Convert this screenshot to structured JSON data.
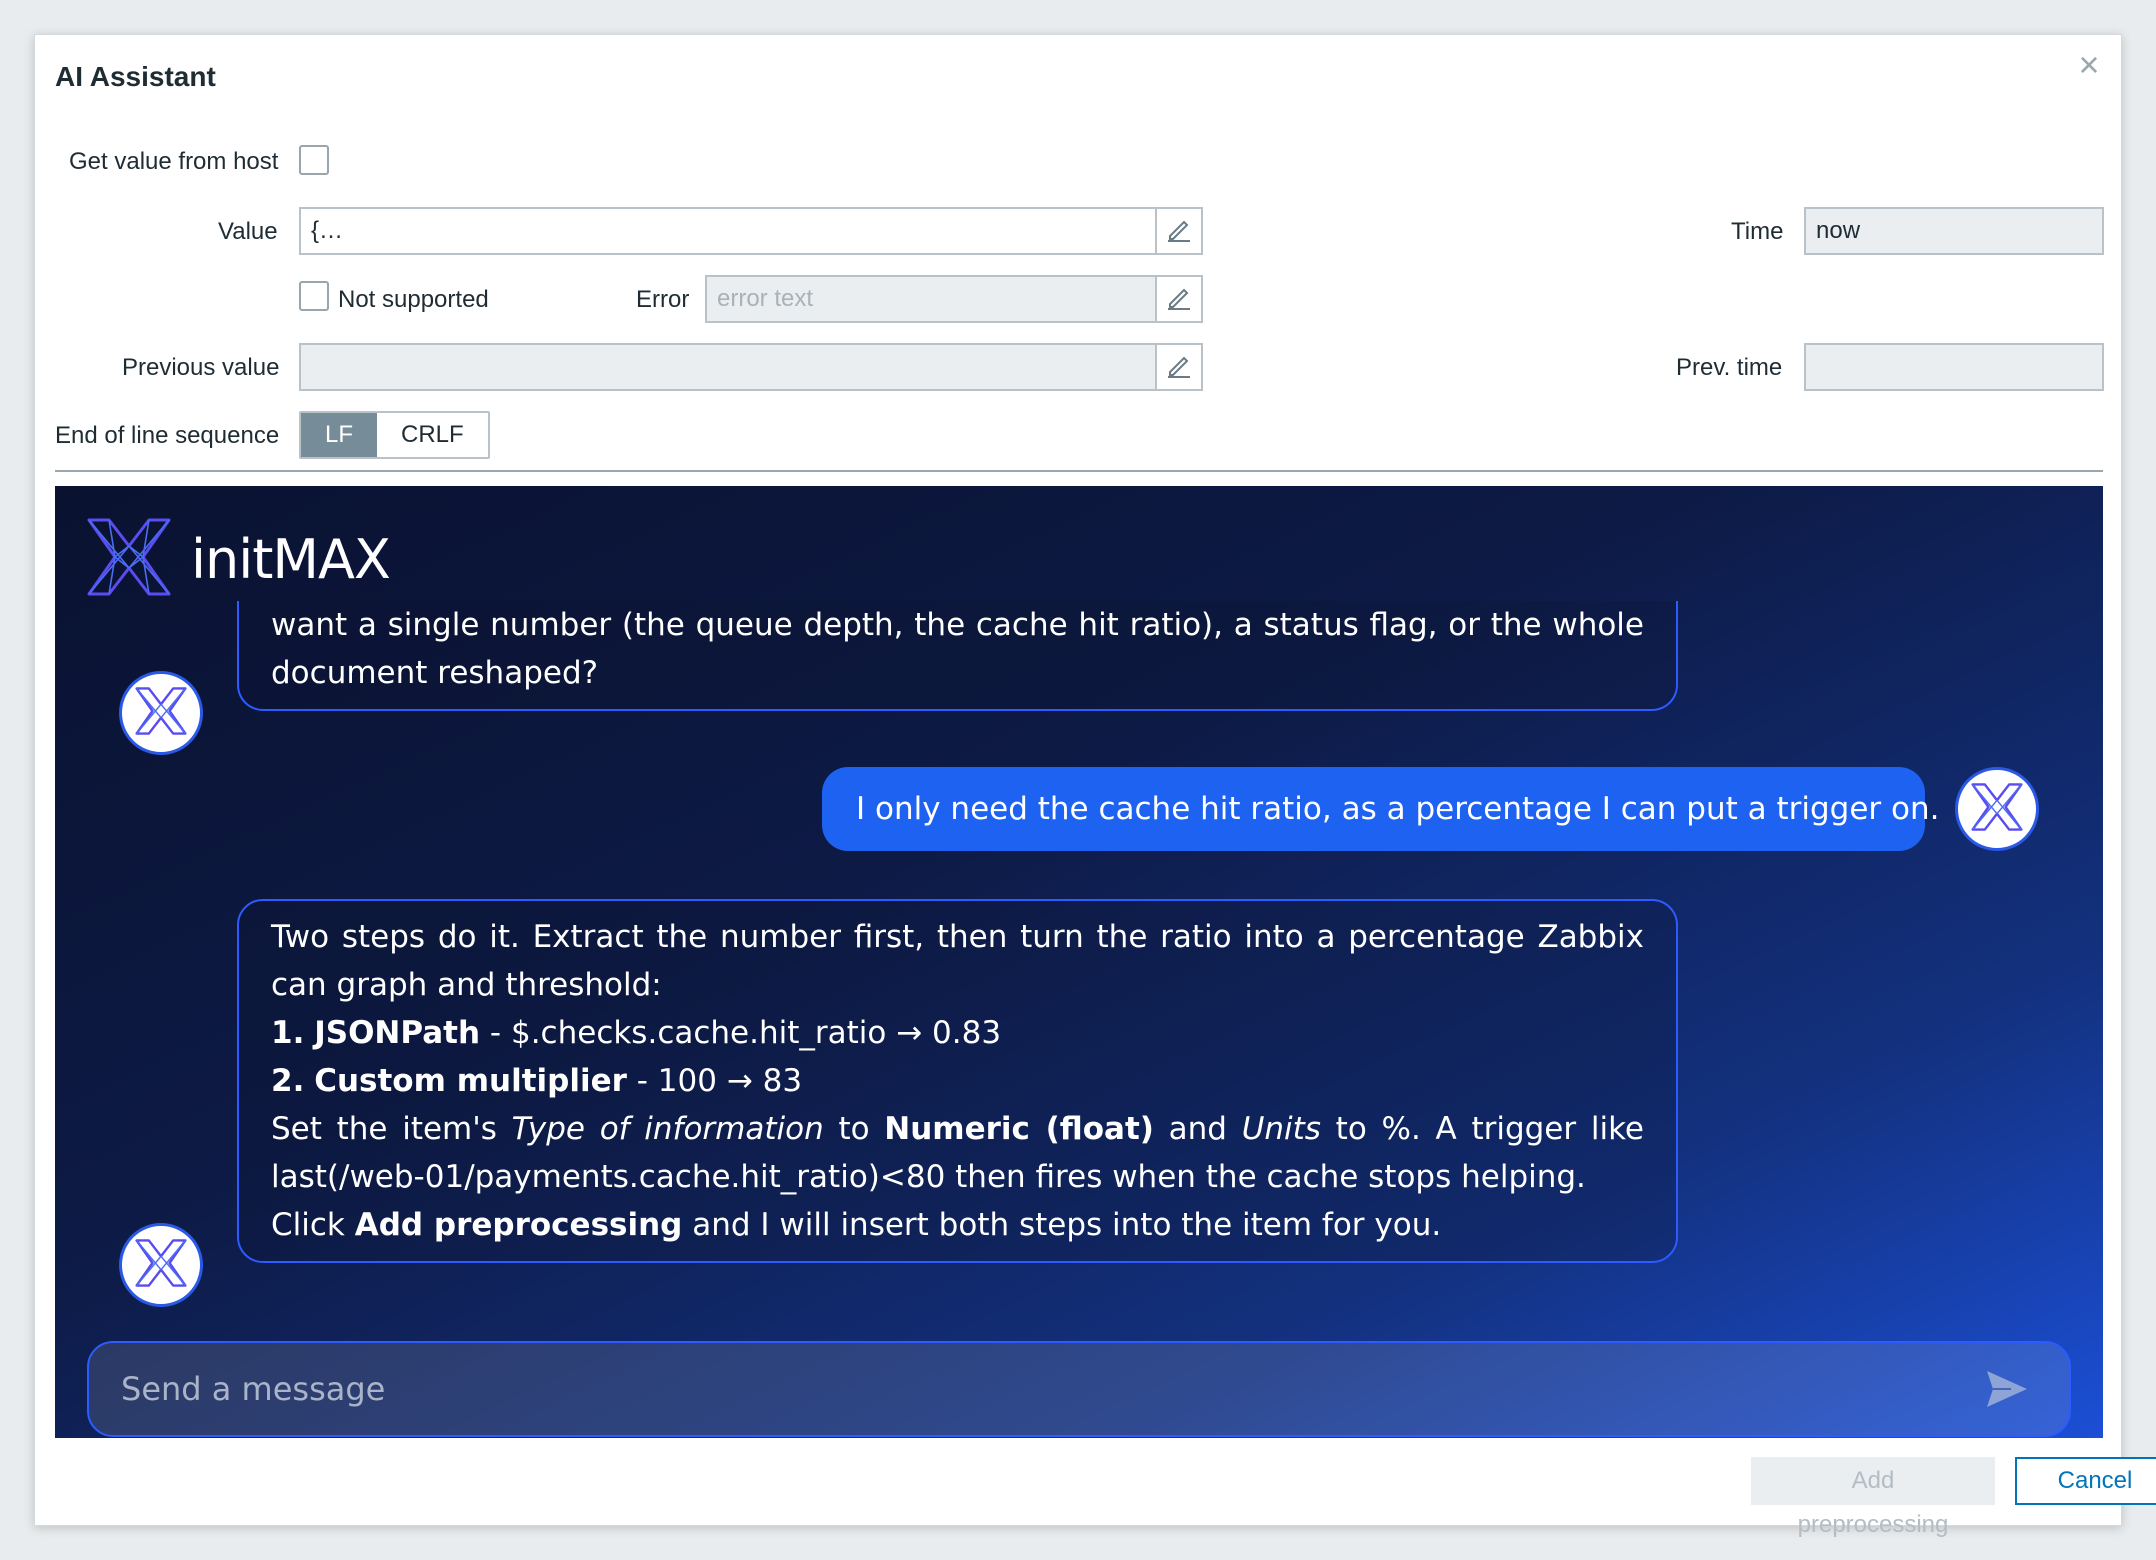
{
  "dialog": {
    "title": "AI Assistant",
    "close_symbol": "×"
  },
  "form": {
    "get_value_label": "Get value from host",
    "value_label": "Value",
    "value_text": "{…",
    "time_label": "Time",
    "time_value": "now",
    "not_supported_label": "Not supported",
    "error_label": "Error",
    "error_placeholder": "error text",
    "previous_value_label": "Previous value",
    "previous_value": "",
    "prev_time_label": "Prev. time",
    "prev_time_value": "",
    "eol_label": "End of line sequence",
    "eol_options": [
      "LF",
      "CRLF"
    ],
    "eol_selected": "LF"
  },
  "chat": {
    "brand": "initMAX",
    "messages": [
      {
        "role": "assistant",
        "text": "want a single number (the queue depth, the cache hit ratio), a status flag, or the whole document reshaped?"
      },
      {
        "role": "user",
        "text": "I only need the cache hit ratio, as a percentage I can put a trigger on."
      },
      {
        "role": "assistant",
        "intro": "Two steps do it. Extract the number first, then turn the ratio into a percentage Zabbix can graph and threshold:",
        "steps": [
          {
            "num": "1.",
            "name": "JSONPath",
            "detail": " - $.checks.cache.hit_ratio → 0.83"
          },
          {
            "num": "2.",
            "name": "Custom multiplier",
            "detail": " - 100 → 83"
          }
        ],
        "note_parts": [
          "Set the item's ",
          "Type of information",
          " to ",
          "Numeric (float)",
          " and ",
          "Units",
          " to %. A trigger like last(/web-01/payments.cache.hit_ratio)<80 then fires when the cache stops helping."
        ],
        "closing_parts": [
          "Click ",
          "Add preprocessing",
          " and I will insert both steps into the item for you."
        ]
      }
    ],
    "input_placeholder": "Send a message"
  },
  "footer": {
    "add_preprocessing_label": "Add preprocessing",
    "cancel_label": "Cancel"
  },
  "colors": {
    "user_bubble": "#1e62f2",
    "bot_border": "#2d5bff",
    "cancel_accent": "#0275b8",
    "toggle_active": "#768d99"
  },
  "icons": {
    "close": "close-icon",
    "edit": "pencil-icon",
    "logo": "initmax-logo-icon",
    "avatar": "initmax-avatar-icon",
    "send": "send-icon"
  }
}
